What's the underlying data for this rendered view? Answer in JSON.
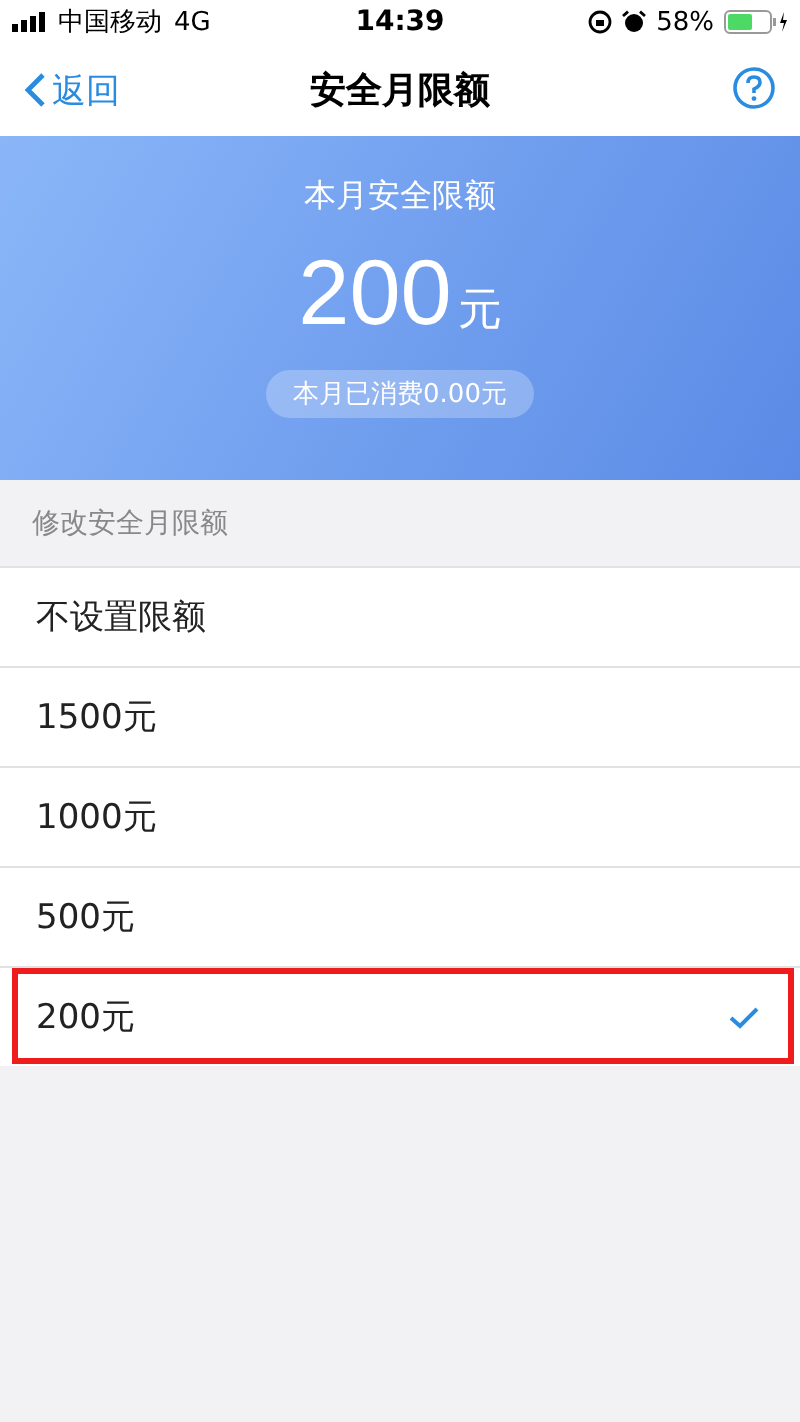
{
  "status_bar": {
    "carrier": "中国移动",
    "network": "4G",
    "time": "14:39",
    "battery": "58%"
  },
  "nav": {
    "back": "返回",
    "title": "安全月限额"
  },
  "banner": {
    "label": "本月安全限额",
    "amount": "200",
    "unit": "元",
    "spent": "本月已消费0.00元"
  },
  "section_header": "修改安全月限额",
  "options": [
    {
      "label": "不设置限额",
      "selected": false,
      "highlighted": false
    },
    {
      "label": "1500元",
      "selected": false,
      "highlighted": false
    },
    {
      "label": "1000元",
      "selected": false,
      "highlighted": false
    },
    {
      "label": "500元",
      "selected": false,
      "highlighted": false
    },
    {
      "label": "200元",
      "selected": true,
      "highlighted": true
    }
  ]
}
